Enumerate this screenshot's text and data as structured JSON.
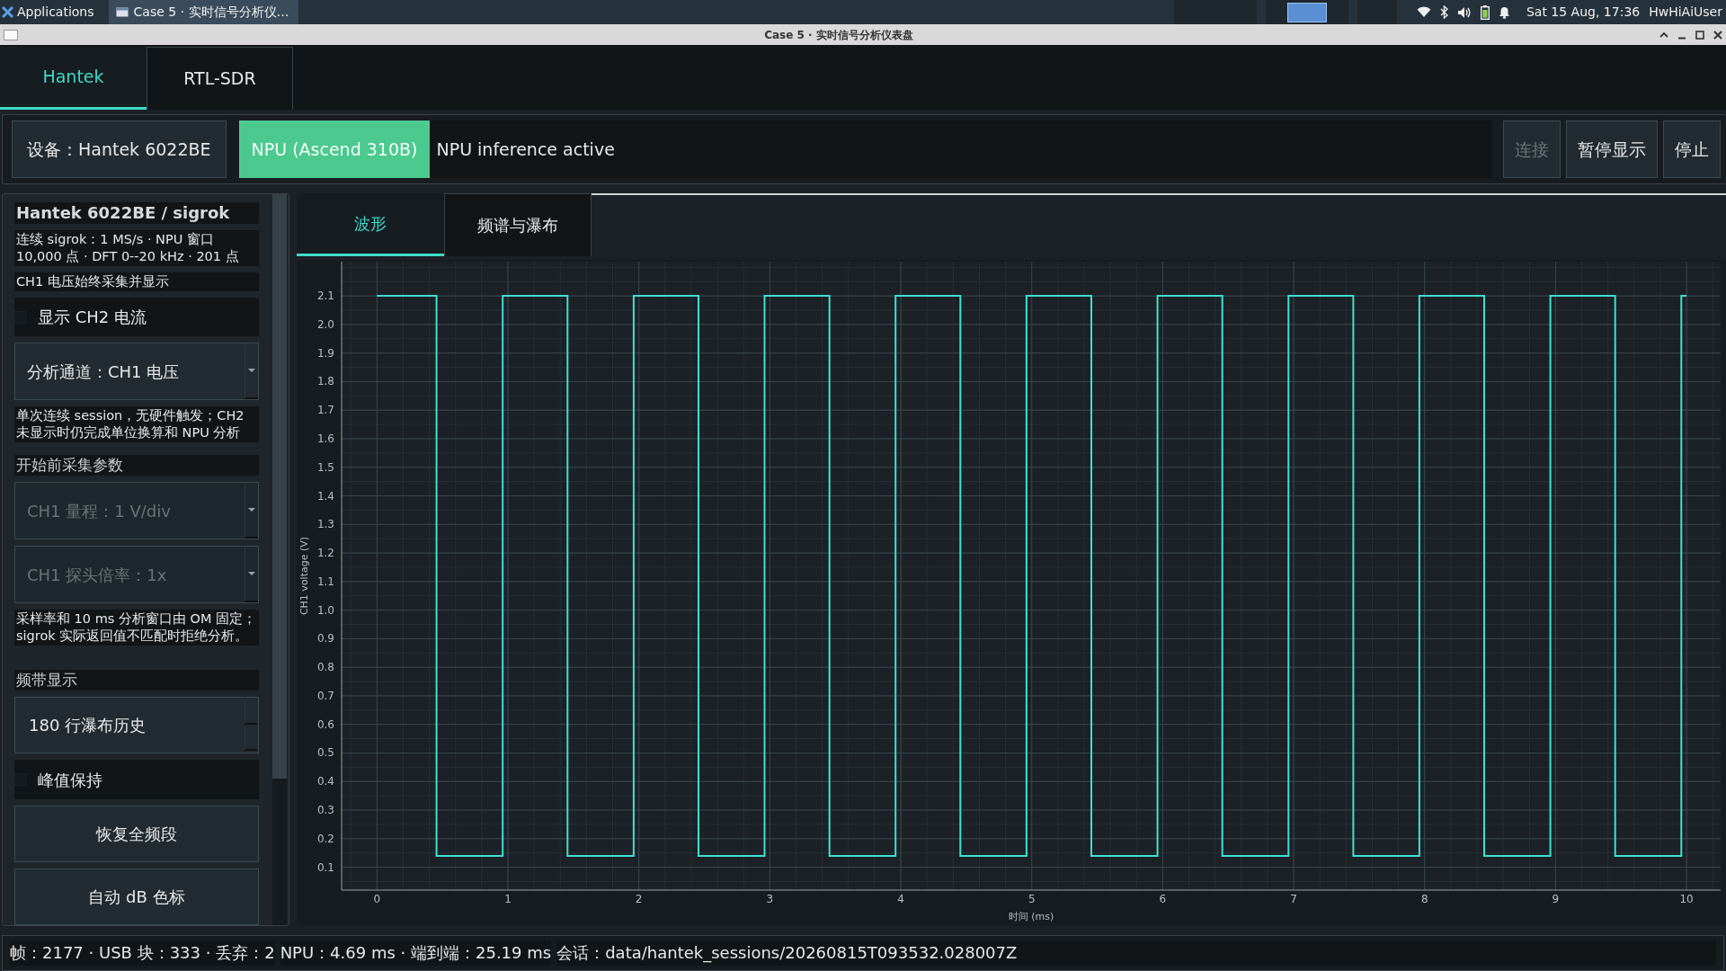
{
  "system_panel": {
    "menu_label": "Applications",
    "task_label": "Case 5 · 实时信号分析仪…",
    "clock": "Sat 15 Aug, 17:36",
    "user": "HwHiAiUser"
  },
  "window": {
    "title": "Case 5 · 实时信号分析仪表盘"
  },
  "device_tabs": [
    {
      "label": "Hantek",
      "selected": true
    },
    {
      "label": "RTL-SDR",
      "selected": false
    }
  ],
  "toolbar": {
    "device": "设备：Hantek 6022BE",
    "npu_badge": "NPU (Ascend 310B)",
    "status": "NPU inference active",
    "buttons": [
      {
        "label": "连接",
        "disabled": true
      },
      {
        "label": "暂停显示",
        "disabled": false
      },
      {
        "label": "停止",
        "disabled": false
      }
    ]
  },
  "sidebar": {
    "items": [
      {
        "kind": "heading",
        "text": "Hantek 6022BE / sigrok"
      },
      {
        "kind": "note",
        "text": "连续 sigrok：1 MS/s · NPU 窗口 10,000 点 · DFT 0--20 kHz · 201 点"
      },
      {
        "kind": "note",
        "text": "CH1 电压始终采集并显示"
      },
      {
        "kind": "checkbox",
        "text": "显示 CH2 电流",
        "checked": false
      },
      {
        "kind": "select",
        "text": "分析通道：CH1 电压",
        "disabled": false
      },
      {
        "kind": "note",
        "text": "单次连续 session，无硬件触发；CH2 未显示时仍完成单位换算和 NPU 分析"
      },
      {
        "kind": "section",
        "text": "开始前采集参数"
      },
      {
        "kind": "select",
        "text": "CH1 量程：1 V/div",
        "disabled": true
      },
      {
        "kind": "select",
        "text": "CH1 探头倍率：1x",
        "disabled": true
      },
      {
        "kind": "note",
        "text": "采样率和 10 ms 分析窗口由 OM 固定；sigrok 实际返回值不匹配时拒绝分析。"
      },
      {
        "kind": "section",
        "text": "频带显示"
      },
      {
        "kind": "spinbox",
        "text": "180 行瀑布历史"
      },
      {
        "kind": "checkbox",
        "text": "峰值保持",
        "checked": false
      },
      {
        "kind": "button",
        "text": "恢复全频段"
      },
      {
        "kind": "button",
        "text": "自动 dB 色标"
      }
    ]
  },
  "view_tabs": [
    {
      "label": "波形",
      "selected": true
    },
    {
      "label": "频谱与瀑布",
      "selected": false
    }
  ],
  "waveform": {
    "chart_data": {
      "type": "line",
      "grid": true,
      "xlabel": "时间 (ms)",
      "ylabel": "CH1 voltage (V)",
      "x": [
        0,
        0.455,
        0.455,
        0.96,
        0.96,
        1.455,
        1.455,
        1.96,
        1.96,
        2.455,
        2.455,
        2.96,
        2.96,
        3.455,
        3.455,
        3.96,
        3.96,
        4.455,
        4.455,
        4.96,
        4.96,
        5.455,
        5.455,
        5.96,
        5.96,
        6.455,
        6.455,
        6.96,
        6.96,
        7.455,
        7.455,
        7.96,
        7.96,
        8.455,
        8.455,
        8.96,
        8.96,
        9.455,
        9.455,
        9.96,
        9.96,
        10
      ],
      "series": [
        {
          "color": "#40e0d0",
          "values": [
            2.1,
            2.1,
            0.14,
            0.14,
            2.1,
            2.1,
            0.14,
            0.14,
            2.1,
            2.1,
            0.14,
            0.14,
            2.1,
            2.1,
            0.14,
            0.14,
            2.1,
            2.1,
            0.14,
            0.14,
            2.1,
            2.1,
            0.14,
            0.14,
            2.1,
            2.1,
            0.14,
            0.14,
            2.1,
            2.1,
            0.14,
            0.14,
            2.1,
            2.1,
            0.14,
            0.14,
            2.1,
            2.1,
            0.14,
            0.14,
            2.1,
            2.1
          ]
        }
      ],
      "xlim": [
        -0.27,
        10.26
      ],
      "ylim": [
        0.02,
        2.22
      ],
      "xticks": [
        0,
        1,
        2,
        3,
        4,
        5,
        6,
        7,
        8,
        9,
        10
      ],
      "yticks": [
        0.1,
        0.2,
        0.3,
        0.4,
        0.5,
        0.6,
        0.7,
        0.8,
        0.9,
        {
          "value": 1.0,
          "label": "1.0"
        },
        1.1,
        1.2,
        1.3,
        1.4,
        1.5,
        1.6,
        1.7,
        1.8,
        1.9,
        {
          "value": 2.0,
          "label": "2.0"
        },
        2.1
      ]
    }
  },
  "status_bar": [
    "帧：2177 · USB 块：333 · 丢弃：2",
    "NPU：4.69 ms · 端到端：25.19 ms",
    "会话：data/hantek_sessions/20260815T093532.028007Z"
  ]
}
